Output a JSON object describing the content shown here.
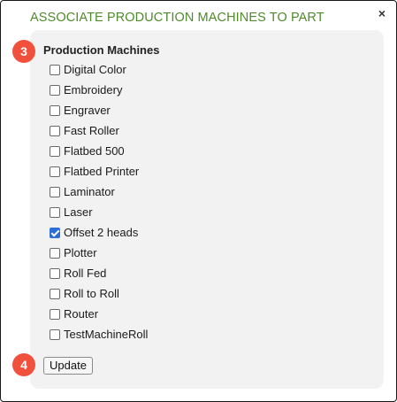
{
  "dialog": {
    "title": "ASSOCIATE PRODUCTION MACHINES TO PART",
    "close_label": "×"
  },
  "section": {
    "label": "Production Machines"
  },
  "machines": [
    {
      "label": "Digital Color",
      "checked": false
    },
    {
      "label": "Embroidery",
      "checked": false
    },
    {
      "label": "Engraver",
      "checked": false
    },
    {
      "label": "Fast Roller",
      "checked": false
    },
    {
      "label": "Flatbed 500",
      "checked": false
    },
    {
      "label": "Flatbed Printer",
      "checked": false
    },
    {
      "label": "Laminator",
      "checked": false
    },
    {
      "label": "Laser",
      "checked": false
    },
    {
      "label": "Offset 2 heads",
      "checked": true
    },
    {
      "label": "Plotter",
      "checked": false
    },
    {
      "label": "Roll Fed",
      "checked": false
    },
    {
      "label": "Roll to Roll",
      "checked": false
    },
    {
      "label": "Router",
      "checked": false
    },
    {
      "label": "TestMachineRoll",
      "checked": false
    }
  ],
  "update_button": {
    "label": "Update"
  },
  "step_badges": {
    "production_machines": "3",
    "update": "4"
  },
  "colors": {
    "title": "#4f8a2a",
    "badge": "#f0503c",
    "checkbox_checked": "#2a6fd6",
    "panel": "#f2f2f2"
  }
}
